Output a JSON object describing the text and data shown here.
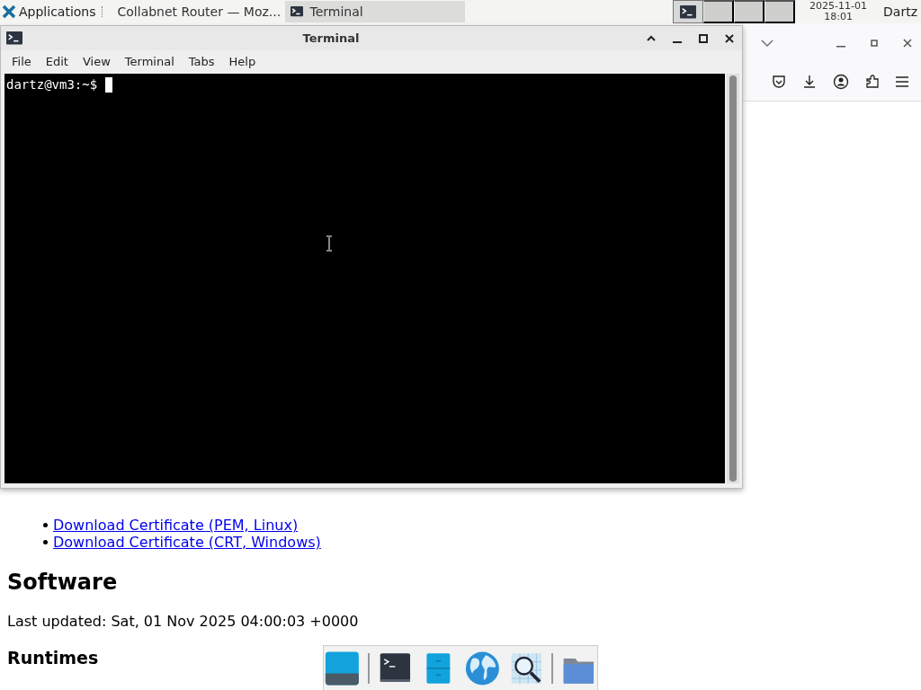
{
  "top_panel": {
    "applications_label": "Applications",
    "tasks": [
      {
        "label": "Collabnet Router — Moz...",
        "kind": "browser",
        "selected": false
      },
      {
        "label": "Terminal",
        "kind": "terminal",
        "selected": true
      }
    ],
    "workspaces": [
      {
        "selected": true
      },
      {
        "selected": false
      },
      {
        "selected": false
      },
      {
        "selected": false
      }
    ],
    "clock": {
      "date": "2025-11-01",
      "time": "18:01"
    },
    "user": "Dartz"
  },
  "browser_page": {
    "links": [
      "Download Certificate (PEM, Linux)",
      "Download Certificate (CRT, Windows)"
    ],
    "heading": "Software",
    "updated": "Last updated: Sat, 01 Nov 2025 04:00:03 +0000",
    "subheading": "Runtimes"
  },
  "terminal": {
    "title": "Terminal",
    "menu": [
      "File",
      "Edit",
      "View",
      "Terminal",
      "Tabs",
      "Help"
    ],
    "prompt": "dartz@vm3:~$"
  },
  "dock": {
    "items": [
      {
        "kind": "desktop"
      },
      {
        "kind": "separator"
      },
      {
        "kind": "terminal"
      },
      {
        "kind": "files"
      },
      {
        "kind": "globe"
      },
      {
        "kind": "search"
      },
      {
        "kind": "separator"
      },
      {
        "kind": "folder"
      }
    ]
  }
}
